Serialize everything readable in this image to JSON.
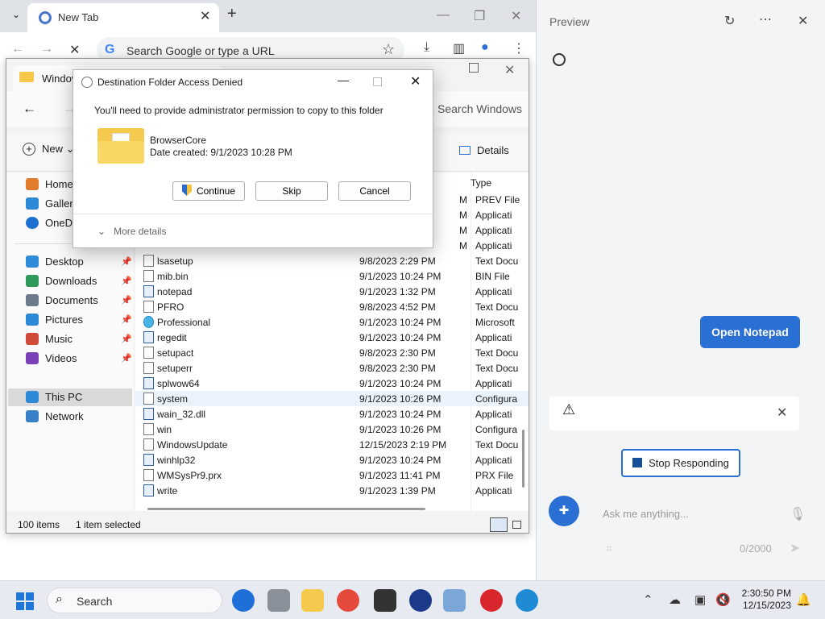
{
  "chrome": {
    "tab_title": "New Tab",
    "omnibox_placeholder": "Search Google or type a URL"
  },
  "explorer": {
    "tab_title": "Windows",
    "search_placeholder": "Search Windows",
    "new_label": "New",
    "details_label": "Details",
    "column_type": "Type",
    "nav": [
      {
        "label": "Home"
      },
      {
        "label": "Gallery"
      },
      {
        "label": "OneDrive"
      },
      {
        "label": "Desktop"
      },
      {
        "label": "Downloads"
      },
      {
        "label": "Documents"
      },
      {
        "label": "Pictures"
      },
      {
        "label": "Music"
      },
      {
        "label": "Videos"
      },
      {
        "label": "This PC"
      },
      {
        "label": "Network"
      }
    ],
    "partial_rows": [
      {
        "date_tail": "M",
        "type": "PREV File"
      },
      {
        "date_tail": "M",
        "type": "Applicati"
      },
      {
        "date_tail": "M",
        "type": "Applicati"
      },
      {
        "date_tail": "M",
        "type": "Applicati"
      }
    ],
    "rows": [
      {
        "name": "lsasetup",
        "date": "9/8/2023 2:29 PM",
        "type": "Text Docu"
      },
      {
        "name": "mib.bin",
        "date": "9/1/2023 10:24 PM",
        "type": "BIN File"
      },
      {
        "name": "notepad",
        "date": "9/1/2023 1:32 PM",
        "type": "Applicati"
      },
      {
        "name": "PFRO",
        "date": "9/8/2023 4:52 PM",
        "type": "Text Docu"
      },
      {
        "name": "Professional",
        "date": "9/1/2023 10:24 PM",
        "type": "Microsoft"
      },
      {
        "name": "regedit",
        "date": "9/1/2023 10:24 PM",
        "type": "Applicati"
      },
      {
        "name": "setupact",
        "date": "9/8/2023 2:30 PM",
        "type": "Text Docu"
      },
      {
        "name": "setuperr",
        "date": "9/8/2023 2:30 PM",
        "type": "Text Docu"
      },
      {
        "name": "splwow64",
        "date": "9/1/2023 10:24 PM",
        "type": "Applicati"
      },
      {
        "name": "system",
        "date": "9/1/2023 10:26 PM",
        "type": "Configura"
      },
      {
        "name": "wain_32.dll",
        "date": "9/1/2023 10:24 PM",
        "type": "Applicati"
      },
      {
        "name": "win",
        "date": "9/1/2023 10:26 PM",
        "type": "Configura"
      },
      {
        "name": "WindowsUpdate",
        "date": "12/15/2023 2:19 PM",
        "type": "Text Docu"
      },
      {
        "name": "winhlp32",
        "date": "9/1/2023 10:24 PM",
        "type": "Applicati"
      },
      {
        "name": "WMSysPr9.prx",
        "date": "9/1/2023 11:41 PM",
        "type": "PRX File"
      },
      {
        "name": "write",
        "date": "9/1/2023 1:39 PM",
        "type": "Applicati"
      }
    ],
    "status_items": "100 items",
    "status_selected": "1 item selected"
  },
  "dialog": {
    "title": "Destination Folder Access Denied",
    "message": "You'll need to provide administrator permission to copy to this folder",
    "folder_name": "BrowserCore",
    "folder_date": "Date created: 9/1/2023 10:28 PM",
    "continue": "Continue",
    "skip": "Skip",
    "cancel": "Cancel",
    "more_details": "More details"
  },
  "preview": {
    "title": "Preview",
    "open_notepad": "Open Notepad",
    "stop_responding": "Stop Responding",
    "ask_placeholder": "Ask me anything...",
    "counter": "0/2000"
  },
  "taskbar": {
    "search_label": "Search",
    "time": "2:30:50 PM",
    "date": "12/15/2023"
  }
}
